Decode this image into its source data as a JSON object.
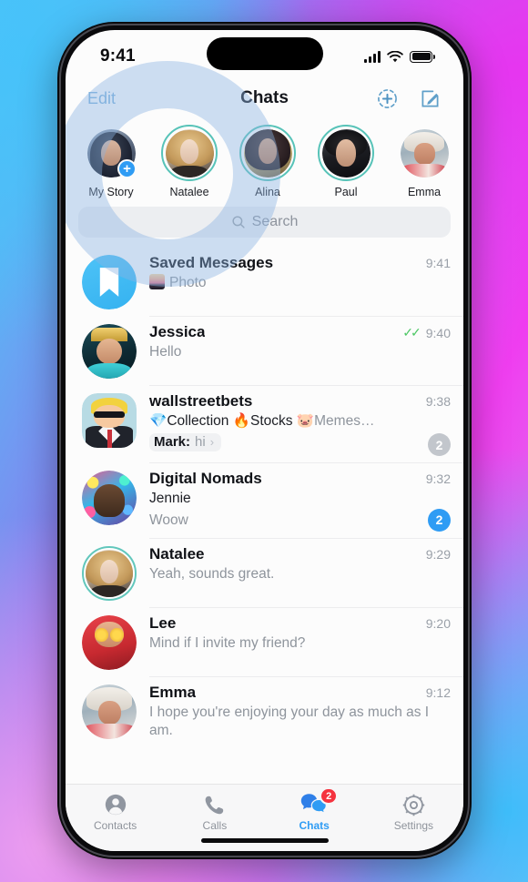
{
  "status_bar": {
    "time": "9:41",
    "cellular_icon": "signal-bars-icon",
    "wifi_icon": "wifi-icon",
    "battery_icon": "battery-full-icon"
  },
  "navbar": {
    "edit_label": "Edit",
    "title": "Chats",
    "add_story_icon": "add-circle-dashed-icon",
    "compose_icon": "compose-pencil-icon"
  },
  "stories": [
    {
      "name": "My Story",
      "has_ring": false,
      "has_plus": true,
      "avatar": "a-mystory"
    },
    {
      "name": "Natalee",
      "has_ring": true,
      "has_plus": false,
      "avatar": "a-natalee"
    },
    {
      "name": "Alina",
      "has_ring": true,
      "has_plus": false,
      "avatar": "a-alina"
    },
    {
      "name": "Paul",
      "has_ring": true,
      "has_plus": false,
      "avatar": "a-paul"
    },
    {
      "name": "Emma",
      "has_ring": false,
      "has_plus": false,
      "avatar": "a-emma"
    }
  ],
  "search": {
    "placeholder": "Search",
    "icon": "search-magnifier-icon"
  },
  "chats": [
    {
      "title": "Saved Messages",
      "time": "9:41",
      "preview": "Photo",
      "has_photo_thumb": true,
      "avatar": "a-saved",
      "avatar_shape": "circle",
      "icon": "bookmark-icon"
    },
    {
      "title": "Jessica",
      "time": "9:40",
      "preview": "Hello",
      "read_ticks": "✓✓",
      "avatar": "a-jessica",
      "avatar_shape": "circle"
    },
    {
      "title": "wallstreetbets",
      "time": "9:38",
      "topics": [
        {
          "emoji": "💎",
          "label": "Collection"
        },
        {
          "emoji": "🔥",
          "label": "Stocks"
        },
        {
          "emoji": "🐷",
          "label": "Memes…",
          "dim": true
        }
      ],
      "reply": {
        "author": "Mark:",
        "text": "hi",
        "arrow": "›"
      },
      "badge": {
        "count": "2",
        "style": "gray"
      },
      "avatar": "a-wsb",
      "avatar_shape": "squircle"
    },
    {
      "title": "Digital Nomads",
      "time": "9:32",
      "author": "Jennie",
      "preview": "Woow",
      "badge": {
        "count": "2",
        "style": "blue"
      },
      "avatar": "a-nomads",
      "avatar_shape": "circle"
    },
    {
      "title": "Natalee",
      "time": "9:29",
      "preview": "Yeah, sounds great.",
      "avatar": "a-natalee",
      "avatar_shape": "circle",
      "story_ring": true
    },
    {
      "title": "Lee",
      "time": "9:20",
      "preview": "Mind if I invite my friend?",
      "avatar": "a-lee",
      "avatar_shape": "circle"
    },
    {
      "title": "Emma",
      "time": "9:12",
      "preview": "I hope you're enjoying your day as much as I am.",
      "avatar": "a-emma",
      "avatar_shape": "circle"
    }
  ],
  "tabbar": [
    {
      "label": "Contacts",
      "icon": "contacts-person-icon",
      "active": false
    },
    {
      "label": "Calls",
      "icon": "phone-handset-icon",
      "active": false
    },
    {
      "label": "Chats",
      "icon": "chat-bubbles-icon",
      "active": true,
      "badge": "2"
    },
    {
      "label": "Settings",
      "icon": "gear-icon",
      "active": false
    }
  ],
  "colors": {
    "accent_blue": "#2f9cf4",
    "story_ring": "#57c3b8",
    "badge_red": "#f5333f",
    "badge_gray": "#c2c6cc",
    "tick_green": "#4cc764",
    "edit_link": "#7fb3dd"
  }
}
